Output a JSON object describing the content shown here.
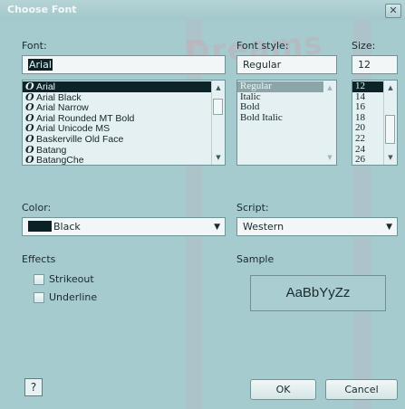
{
  "window": {
    "title": "Choose Font",
    "close_glyph": "✕"
  },
  "watermark": {
    "text": "Dreams"
  },
  "font": {
    "label": "Font:",
    "value": "Arial",
    "items": [
      {
        "name": "Arial",
        "icon": "opentype-icon"
      },
      {
        "name": "Arial Black",
        "icon": "opentype-icon"
      },
      {
        "name": "Arial Narrow",
        "icon": "opentype-icon"
      },
      {
        "name": "Arial Rounded MT Bold",
        "icon": "opentype-icon"
      },
      {
        "name": "Arial Unicode MS",
        "icon": "opentype-icon"
      },
      {
        "name": "Baskerville Old Face",
        "icon": "opentype-icon"
      },
      {
        "name": "Batang",
        "icon": "opentype-icon"
      },
      {
        "name": "BatangChe",
        "icon": "opentype-icon"
      }
    ],
    "selected_index": 0,
    "icon_glyph": "O"
  },
  "style": {
    "label": "Font style:",
    "value": "Regular",
    "items": [
      "Regular",
      "Italic",
      "Bold",
      "Bold Italic"
    ],
    "selected_index": 0
  },
  "size": {
    "label": "Size:",
    "value": "12",
    "items": [
      "12",
      "14",
      "16",
      "18",
      "20",
      "22",
      "24",
      "26"
    ],
    "selected_index": 0
  },
  "color": {
    "label": "Color:",
    "value": "Black",
    "swatch": "#0a2024"
  },
  "script": {
    "label": "Script:",
    "value": "Western"
  },
  "effects": {
    "label": "Effects",
    "strikeout": {
      "label": "Strikeout",
      "checked": false
    },
    "underline": {
      "label": "Underline",
      "checked": false
    }
  },
  "sample": {
    "label": "Sample",
    "text": "AaBbYyZz"
  },
  "buttons": {
    "help": "?",
    "ok": "OK",
    "cancel": "Cancel"
  },
  "colors": {
    "dialog_bg": "#a6cbce",
    "selection": "#0c2428"
  }
}
